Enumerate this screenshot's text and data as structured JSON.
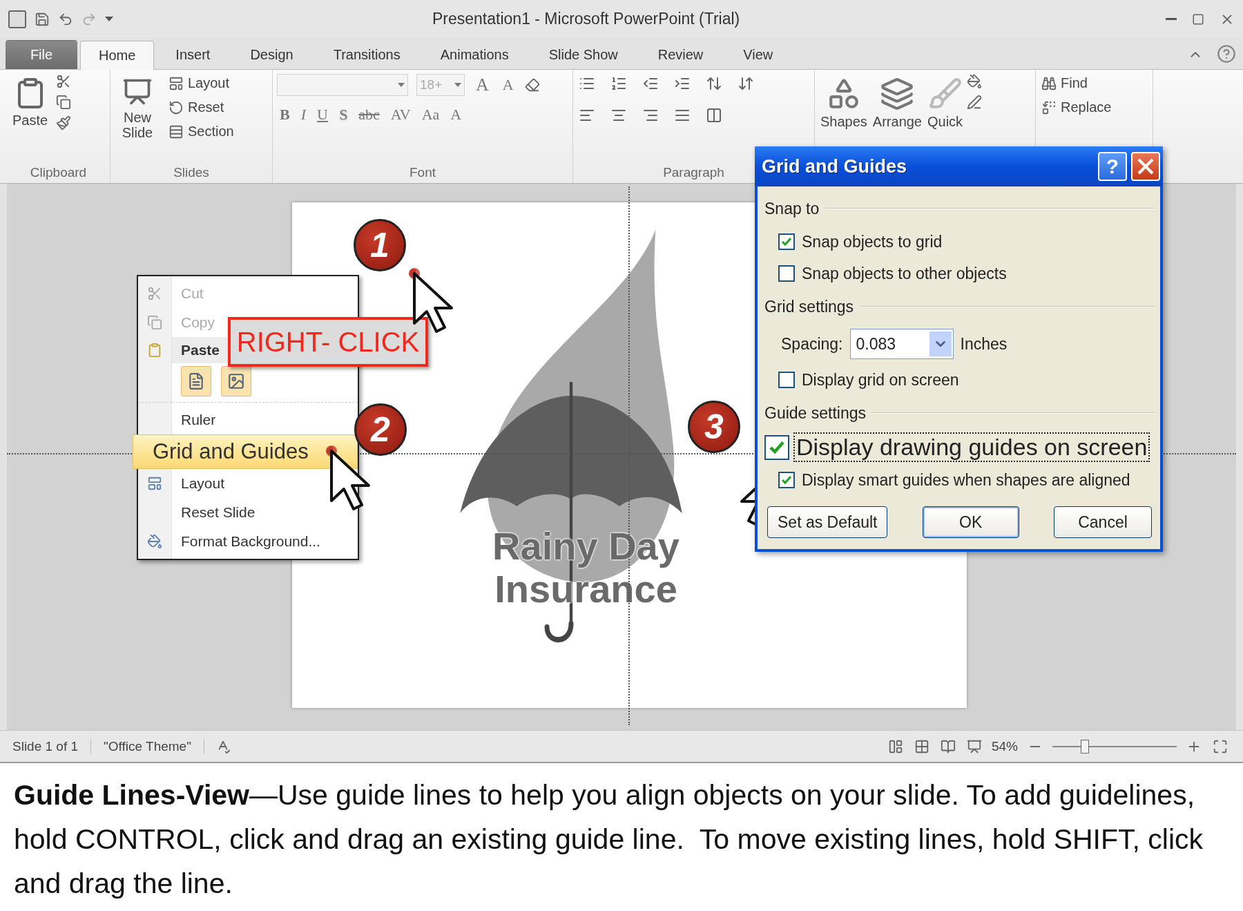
{
  "title_bar": {
    "title": "Presentation1  -  Microsoft PowerPoint (Trial)"
  },
  "ribbon_tabs": [
    {
      "label": "File",
      "kind": "file",
      "selected": false
    },
    {
      "label": "Home",
      "kind": "tab",
      "selected": true
    },
    {
      "label": "Insert",
      "kind": "tab",
      "selected": false
    },
    {
      "label": "Design",
      "kind": "tab",
      "selected": false
    },
    {
      "label": "Transitions",
      "kind": "tab",
      "selected": false
    },
    {
      "label": "Animations",
      "kind": "tab",
      "selected": false
    },
    {
      "label": "Slide Show",
      "kind": "tab",
      "selected": false
    },
    {
      "label": "Review",
      "kind": "tab",
      "selected": false
    },
    {
      "label": "View",
      "kind": "tab",
      "selected": false
    }
  ],
  "ribbon": {
    "clipboard": {
      "label": "Clipboard",
      "paste": "Paste"
    },
    "slides": {
      "label": "Slides",
      "new_slide": "New Slide",
      "layout": "Layout",
      "reset": "Reset",
      "section": "Section"
    },
    "font": {
      "label": "Font",
      "size": "18+",
      "size_buttons": [
        "A",
        "A"
      ],
      "format_buttons": [
        "B",
        "I",
        "U",
        "S",
        "abc",
        "AV",
        "Aa",
        "A"
      ]
    },
    "paragraph": {
      "label": "Paragraph"
    },
    "drawing": {
      "buttons": [
        "Shapes",
        "Arrange",
        "Quick"
      ]
    },
    "editing": {
      "find": "Find",
      "replace": "Replace"
    }
  },
  "slide": {
    "title_lines": [
      "Rainy Day",
      "Insurance"
    ]
  },
  "context_menu": {
    "items": [
      {
        "kind": "command",
        "label": "Cut",
        "disabled": true,
        "selected": false
      },
      {
        "kind": "command",
        "label": "Copy",
        "disabled": true,
        "selected": false
      },
      {
        "kind": "header",
        "label": "Paste"
      },
      {
        "kind": "paste_options"
      },
      {
        "kind": "command",
        "label": "Ruler",
        "disabled": false,
        "selected": false
      },
      {
        "kind": "command",
        "label": "Grid and Guides",
        "disabled": false,
        "selected": true
      },
      {
        "kind": "command",
        "label": "Layout",
        "disabled": false,
        "selected": false
      },
      {
        "kind": "command",
        "label": "Reset Slide",
        "disabled": false,
        "selected": false
      },
      {
        "kind": "command",
        "label": "Format Background...",
        "disabled": false,
        "selected": false
      }
    ]
  },
  "annotation": "RIGHT- CLICK",
  "callouts": [
    {
      "number": "1"
    },
    {
      "number": "2"
    },
    {
      "number": "3"
    }
  ],
  "dialog": {
    "title": "Grid and Guides",
    "help": "?",
    "sections": [
      {
        "label": "Snap to",
        "rows": [
          {
            "kind": "checkbox",
            "label": "Snap objects to grid",
            "checked": true,
            "focused": false
          },
          {
            "kind": "checkbox",
            "label": "Snap objects to other objects",
            "checked": false,
            "focused": false
          }
        ]
      },
      {
        "label": "Grid settings",
        "rows": [
          {
            "kind": "spacing",
            "label": "Spacing:",
            "value": "0.083",
            "unit": "Inches"
          },
          {
            "kind": "checkbox",
            "label": "Display grid on screen",
            "checked": false,
            "focused": false
          }
        ]
      },
      {
        "label": "Guide settings",
        "rows": [
          {
            "kind": "checkbox",
            "label": "Display drawing guides on screen",
            "checked": true,
            "focused": true
          },
          {
            "kind": "checkbox",
            "label": "Display smart guides when shapes are aligned",
            "checked": true,
            "focused": false
          }
        ]
      }
    ],
    "buttons": [
      {
        "label": "Set as Default",
        "default": false
      },
      {
        "label": "OK",
        "default": true
      },
      {
        "label": "Cancel",
        "default": false
      }
    ]
  },
  "status_bar": {
    "slide": "Slide 1 of 1",
    "theme": "\"Office Theme\"",
    "zoom": "54%",
    "zoom_slider": {
      "level": 0.26
    }
  },
  "caption": {
    "text": "**Guide Lines-View**—Use guide lines to help you align objects on your slide. To add guidelines, hold CONTROL, click and drag an existing guide line.  To move existing lines, hold SHIFT, click and drag the line."
  }
}
